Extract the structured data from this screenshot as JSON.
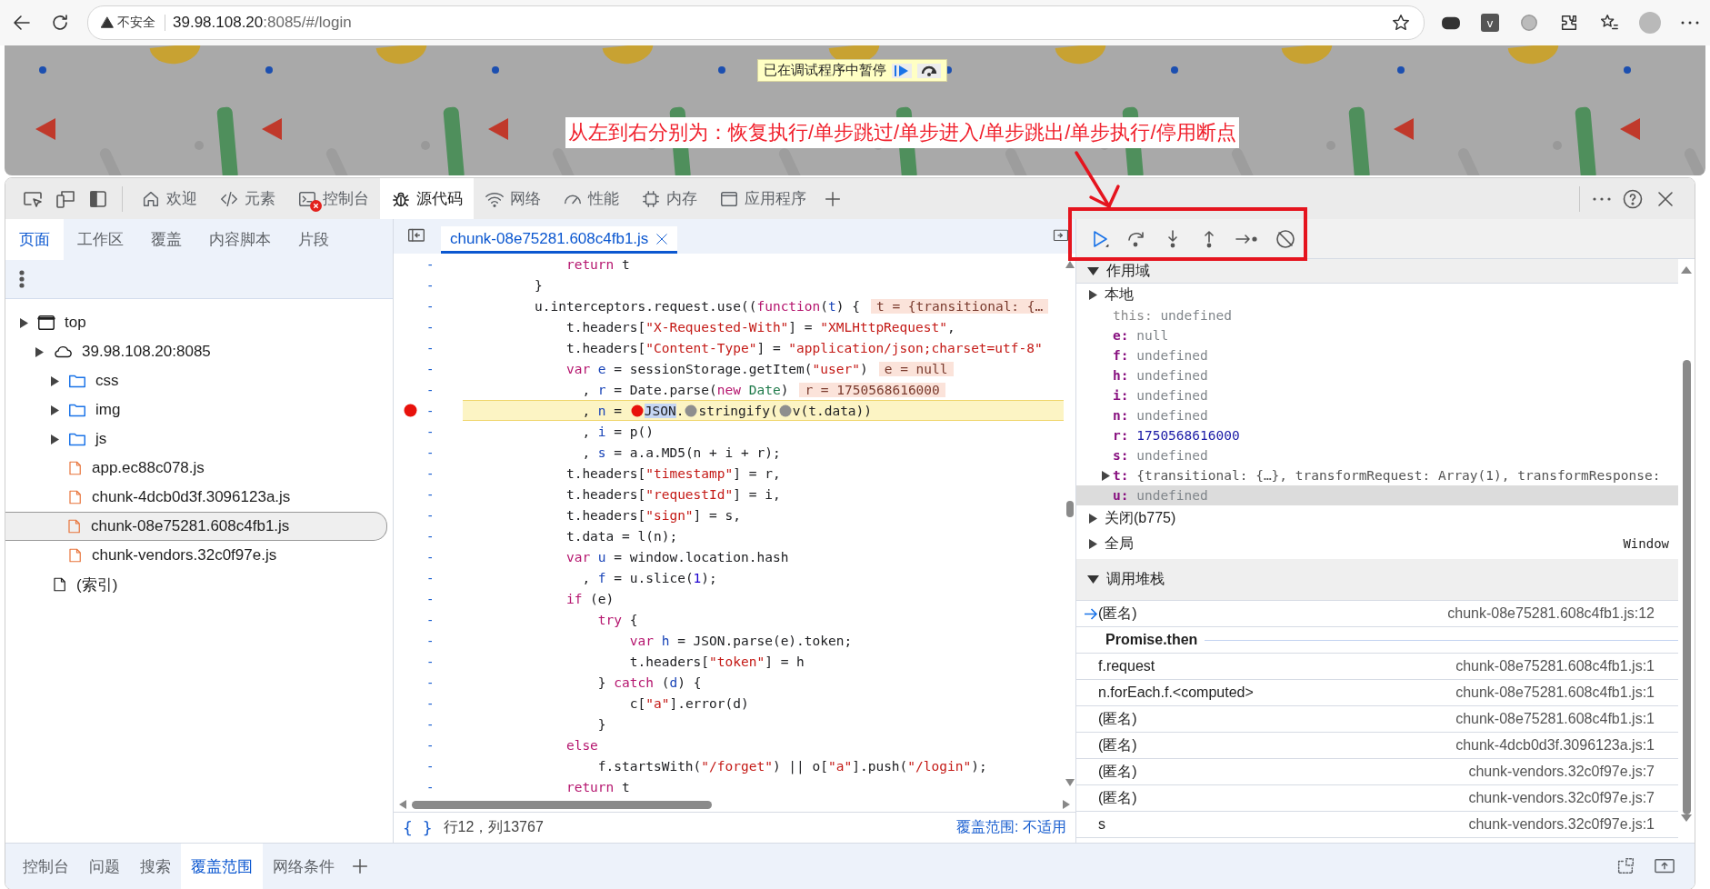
{
  "browser": {
    "security": "不安全",
    "url_host": "39.98.108.20",
    "url_path": ":8085/#/login",
    "extension_letter": "v"
  },
  "page": {
    "paused_message": "已在调试程序中暂停",
    "annotation": "从左到右分别为：恢复执行/单步跳过/单步进入/单步跳出/单步执行/停用断点"
  },
  "devtools": {
    "tabs": [
      {
        "label": "欢迎",
        "selected": false,
        "error_badge": false
      },
      {
        "label": "元素",
        "selected": false,
        "error_badge": false
      },
      {
        "label": "控制台",
        "selected": false,
        "error_badge": true
      },
      {
        "label": "源代码",
        "selected": true,
        "error_badge": false
      },
      {
        "label": "网络",
        "selected": false,
        "error_badge": false
      },
      {
        "label": "性能",
        "selected": false,
        "error_badge": false
      },
      {
        "label": "内存",
        "selected": false,
        "error_badge": false
      },
      {
        "label": "应用程序",
        "selected": false,
        "error_badge": false
      }
    ],
    "navigator": {
      "tabs": [
        {
          "label": "页面",
          "selected": true
        },
        {
          "label": "工作区",
          "selected": false
        },
        {
          "label": "覆盖",
          "selected": false
        },
        {
          "label": "内容脚本",
          "selected": false
        },
        {
          "label": "片段",
          "selected": false
        }
      ],
      "tree": [
        {
          "kind": "frame",
          "label": "top",
          "selected": false,
          "children": [
            {
              "kind": "origin",
              "label": "39.98.108.20:8085",
              "selected": false,
              "children": [
                {
                  "kind": "folder",
                  "label": "css",
                  "selected": false
                },
                {
                  "kind": "folder",
                  "label": "img",
                  "selected": false
                },
                {
                  "kind": "folder",
                  "label": "js",
                  "selected": false
                },
                {
                  "kind": "file",
                  "label": "app.ec88c078.js",
                  "selected": false
                },
                {
                  "kind": "file",
                  "label": "chunk-4dcb0d3f.3096123a.js",
                  "selected": false
                },
                {
                  "kind": "file",
                  "label": "chunk-08e75281.608c4fb1.js",
                  "selected": true
                },
                {
                  "kind": "file",
                  "label": "chunk-vendors.32c0f97e.js",
                  "selected": false
                }
              ]
            },
            {
              "kind": "index",
              "label": "(索引)",
              "selected": false
            }
          ]
        }
      ]
    },
    "editor": {
      "file_tab": "chunk-08e75281.608c4fb1.js",
      "lines": [
        {
          "gutter": "-",
          "breakpoint": false,
          "paused": false,
          "tokens": [
            {
              "kind": "keyword",
              "text": "    return"
            },
            {
              "kind": "plain",
              "text": " t"
            }
          ]
        },
        {
          "gutter": "-",
          "breakpoint": false,
          "paused": false,
          "tokens": [
            {
              "kind": "plain",
              "text": "}"
            }
          ]
        },
        {
          "gutter": "-",
          "breakpoint": false,
          "paused": false,
          "tokens": [
            {
              "kind": "plain",
              "text": "u.interceptors.request.use(("
            },
            {
              "kind": "keyword",
              "text": "function"
            },
            {
              "kind": "plain",
              "text": "("
            },
            {
              "kind": "name",
              "text": "t"
            },
            {
              "kind": "plain",
              "text": ") {"
            }
          ],
          "inline_value": "t = {transitional: {…"
        },
        {
          "gutter": "-",
          "breakpoint": false,
          "paused": false,
          "tokens": [
            {
              "kind": "plain",
              "text": "    t.headers["
            },
            {
              "kind": "string",
              "text": "\"X-Requested-With\""
            },
            {
              "kind": "plain",
              "text": "] = "
            },
            {
              "kind": "string",
              "text": "\"XMLHttpRequest\""
            },
            {
              "kind": "plain",
              "text": ","
            }
          ]
        },
        {
          "gutter": "-",
          "breakpoint": false,
          "paused": false,
          "tokens": [
            {
              "kind": "plain",
              "text": "    t.headers["
            },
            {
              "kind": "string",
              "text": "\"Content-Type\""
            },
            {
              "kind": "plain",
              "text": "] = "
            },
            {
              "kind": "string",
              "text": "\"application/json;charset=utf-8\""
            }
          ]
        },
        {
          "gutter": "-",
          "breakpoint": false,
          "paused": false,
          "tokens": [
            {
              "kind": "keyword",
              "text": "    var"
            },
            {
              "kind": "name",
              "text": " e"
            },
            {
              "kind": "plain",
              "text": " = sessionStorage.getItem("
            },
            {
              "kind": "string",
              "text": "\"user\""
            },
            {
              "kind": "plain",
              "text": ")"
            }
          ],
          "inline_value": "e = null"
        },
        {
          "gutter": "-",
          "breakpoint": false,
          "paused": false,
          "tokens": [
            {
              "kind": "plain",
              "text": "      , "
            },
            {
              "kind": "name",
              "text": "r"
            },
            {
              "kind": "plain",
              "text": " = Date.parse("
            },
            {
              "kind": "keyword",
              "text": "new"
            },
            {
              "kind": "class",
              "text": " Date"
            },
            {
              "kind": "plain",
              "text": ")"
            }
          ],
          "inline_value": "r = 1750568616000"
        },
        {
          "gutter": "-",
          "breakpoint": true,
          "paused": true,
          "tokens": [
            {
              "kind": "plain",
              "text": "      , "
            },
            {
              "kind": "name",
              "text": "n"
            },
            {
              "kind": "plain",
              "text": " = "
            },
            {
              "kind": "inline_breakpoint",
              "active": true
            },
            {
              "kind": "selection",
              "text": "JSON"
            },
            {
              "kind": "plain",
              "text": "."
            },
            {
              "kind": "inline_breakpoint",
              "active": false
            },
            {
              "kind": "plain",
              "text": "stringify("
            },
            {
              "kind": "inline_breakpoint",
              "active": false
            },
            {
              "kind": "plain",
              "text": "v(t.data))"
            }
          ]
        },
        {
          "gutter": "-",
          "breakpoint": false,
          "paused": false,
          "tokens": [
            {
              "kind": "plain",
              "text": "      , "
            },
            {
              "kind": "name",
              "text": "i"
            },
            {
              "kind": "plain",
              "text": " = p()"
            }
          ]
        },
        {
          "gutter": "-",
          "breakpoint": false,
          "paused": false,
          "tokens": [
            {
              "kind": "plain",
              "text": "      , "
            },
            {
              "kind": "name",
              "text": "s"
            },
            {
              "kind": "plain",
              "text": " = a.a.MD5(n + i + r);"
            }
          ]
        },
        {
          "gutter": "-",
          "breakpoint": false,
          "paused": false,
          "tokens": [
            {
              "kind": "plain",
              "text": "    t.headers["
            },
            {
              "kind": "string",
              "text": "\"timestamp\""
            },
            {
              "kind": "plain",
              "text": "] = r,"
            }
          ]
        },
        {
          "gutter": "-",
          "breakpoint": false,
          "paused": false,
          "tokens": [
            {
              "kind": "plain",
              "text": "    t.headers["
            },
            {
              "kind": "string",
              "text": "\"requestId\""
            },
            {
              "kind": "plain",
              "text": "] = i,"
            }
          ]
        },
        {
          "gutter": "-",
          "breakpoint": false,
          "paused": false,
          "tokens": [
            {
              "kind": "plain",
              "text": "    t.headers["
            },
            {
              "kind": "string",
              "text": "\"sign\""
            },
            {
              "kind": "plain",
              "text": "] = s,"
            }
          ]
        },
        {
          "gutter": "-",
          "breakpoint": false,
          "paused": false,
          "tokens": [
            {
              "kind": "plain",
              "text": "    t.data = l(n);"
            }
          ]
        },
        {
          "gutter": "-",
          "breakpoint": false,
          "paused": false,
          "tokens": [
            {
              "kind": "keyword",
              "text": "    var"
            },
            {
              "kind": "name",
              "text": " u"
            },
            {
              "kind": "plain",
              "text": " = window.location.hash"
            }
          ]
        },
        {
          "gutter": "-",
          "breakpoint": false,
          "paused": false,
          "tokens": [
            {
              "kind": "plain",
              "text": "      , "
            },
            {
              "kind": "name",
              "text": "f"
            },
            {
              "kind": "plain",
              "text": " = u.slice("
            },
            {
              "kind": "number",
              "text": "1"
            },
            {
              "kind": "plain",
              "text": ");"
            }
          ]
        },
        {
          "gutter": "-",
          "breakpoint": false,
          "paused": false,
          "tokens": [
            {
              "kind": "keyword",
              "text": "    if"
            },
            {
              "kind": "plain",
              "text": " (e)"
            }
          ]
        },
        {
          "gutter": "-",
          "breakpoint": false,
          "paused": false,
          "tokens": [
            {
              "kind": "keyword",
              "text": "        try"
            },
            {
              "kind": "plain",
              "text": " {"
            }
          ]
        },
        {
          "gutter": "-",
          "breakpoint": false,
          "paused": false,
          "tokens": [
            {
              "kind": "keyword",
              "text": "            var"
            },
            {
              "kind": "name",
              "text": " h"
            },
            {
              "kind": "plain",
              "text": " = JSON.parse(e).token;"
            }
          ]
        },
        {
          "gutter": "-",
          "breakpoint": false,
          "paused": false,
          "tokens": [
            {
              "kind": "plain",
              "text": "            t.headers["
            },
            {
              "kind": "string",
              "text": "\"token\""
            },
            {
              "kind": "plain",
              "text": "] = h"
            }
          ]
        },
        {
          "gutter": "-",
          "breakpoint": false,
          "paused": false,
          "tokens": [
            {
              "kind": "plain",
              "text": "        } "
            },
            {
              "kind": "keyword",
              "text": "catch"
            },
            {
              "kind": "plain",
              "text": " ("
            },
            {
              "kind": "name",
              "text": "d"
            },
            {
              "kind": "plain",
              "text": ") {"
            }
          ]
        },
        {
          "gutter": "-",
          "breakpoint": false,
          "paused": false,
          "tokens": [
            {
              "kind": "plain",
              "text": "            c["
            },
            {
              "kind": "string",
              "text": "\"a\""
            },
            {
              "kind": "plain",
              "text": "].error(d)"
            }
          ]
        },
        {
          "gutter": "-",
          "breakpoint": false,
          "paused": false,
          "tokens": [
            {
              "kind": "plain",
              "text": "        }"
            }
          ]
        },
        {
          "gutter": "-",
          "breakpoint": false,
          "paused": false,
          "tokens": [
            {
              "kind": "keyword",
              "text": "    else"
            }
          ]
        },
        {
          "gutter": "-",
          "breakpoint": false,
          "paused": false,
          "tokens": [
            {
              "kind": "plain",
              "text": "        f.startsWith("
            },
            {
              "kind": "string",
              "text": "\"/forget\""
            },
            {
              "kind": "plain",
              "text": ") || o["
            },
            {
              "kind": "string",
              "text": "\"a\""
            },
            {
              "kind": "plain",
              "text": "].push("
            },
            {
              "kind": "string",
              "text": "\"/login\""
            },
            {
              "kind": "plain",
              "text": ");"
            }
          ]
        },
        {
          "gutter": "-",
          "breakpoint": false,
          "paused": false,
          "tokens": [
            {
              "kind": "keyword",
              "text": "    return"
            },
            {
              "kind": "plain",
              "text": " t"
            }
          ]
        }
      ],
      "status": {
        "format_button": "{ }",
        "position": "行12，列13767",
        "coverage": "覆盖范围: 不适用"
      }
    },
    "debugger": {
      "scope": {
        "title": "作用域",
        "expanded": true,
        "sections": [
          {
            "label": "本地",
            "variables": [
              {
                "name": "this:",
                "value": "undefined",
                "kind": "receiver",
                "expandable": false,
                "selected": false
              },
              {
                "name": "e:",
                "value": "null",
                "kind": "empty",
                "expandable": false,
                "selected": false
              },
              {
                "name": "f:",
                "value": "undefined",
                "kind": "empty",
                "expandable": false,
                "selected": false
              },
              {
                "name": "h:",
                "value": "undefined",
                "kind": "empty",
                "expandable": false,
                "selected": false
              },
              {
                "name": "i:",
                "value": "undefined",
                "kind": "empty",
                "expandable": false,
                "selected": false
              },
              {
                "name": "n:",
                "value": "undefined",
                "kind": "empty",
                "expandable": false,
                "selected": false
              },
              {
                "name": "r:",
                "value": "1750568616000",
                "kind": "number",
                "expandable": false,
                "selected": false
              },
              {
                "name": "s:",
                "value": "undefined",
                "kind": "empty",
                "expandable": false,
                "selected": false
              },
              {
                "name": "t:",
                "value": "{transitional: {…}, transformRequest: Array(1), transformResponse:",
                "kind": "object",
                "expandable": true,
                "selected": false
              },
              {
                "name": "u:",
                "value": "undefined",
                "kind": "empty",
                "expandable": false,
                "selected": true
              }
            ]
          },
          {
            "label": "关闭(b775)"
          },
          {
            "label": "全局",
            "value": "Window"
          }
        ]
      },
      "call_stack": {
        "title": "调用堆栈",
        "expanded": true,
        "frames": [
          {
            "kind": "frame",
            "name": "(匿名)",
            "location": "chunk-08e75281.608c4fb1.js:12",
            "selected": true
          },
          {
            "kind": "async",
            "name": "Promise.then"
          },
          {
            "kind": "frame",
            "name": "f.request",
            "location": "chunk-08e75281.608c4fb1.js:1",
            "selected": false
          },
          {
            "kind": "frame",
            "name": "n.forEach.f.<computed>",
            "location": "chunk-08e75281.608c4fb1.js:1",
            "selected": false
          },
          {
            "kind": "frame",
            "name": "(匿名)",
            "location": "chunk-08e75281.608c4fb1.js:1",
            "selected": false
          },
          {
            "kind": "frame",
            "name": "(匿名)",
            "location": "chunk-4dcb0d3f.3096123a.js:1",
            "selected": false
          },
          {
            "kind": "frame",
            "name": "(匿名)",
            "location": "chunk-vendors.32c0f97e.js:7",
            "selected": false
          },
          {
            "kind": "frame",
            "name": "(匿名)",
            "location": "chunk-vendors.32c0f97e.js:7",
            "selected": false
          },
          {
            "kind": "frame",
            "name": "s",
            "location": "chunk-vendors.32c0f97e.js:1",
            "selected": false
          }
        ]
      }
    },
    "drawer": {
      "tabs": [
        {
          "label": "控制台",
          "selected": false
        },
        {
          "label": "问题",
          "selected": false
        },
        {
          "label": "搜索",
          "selected": false
        },
        {
          "label": "覆盖范围",
          "selected": true
        },
        {
          "label": "网络条件",
          "selected": false
        }
      ]
    }
  }
}
